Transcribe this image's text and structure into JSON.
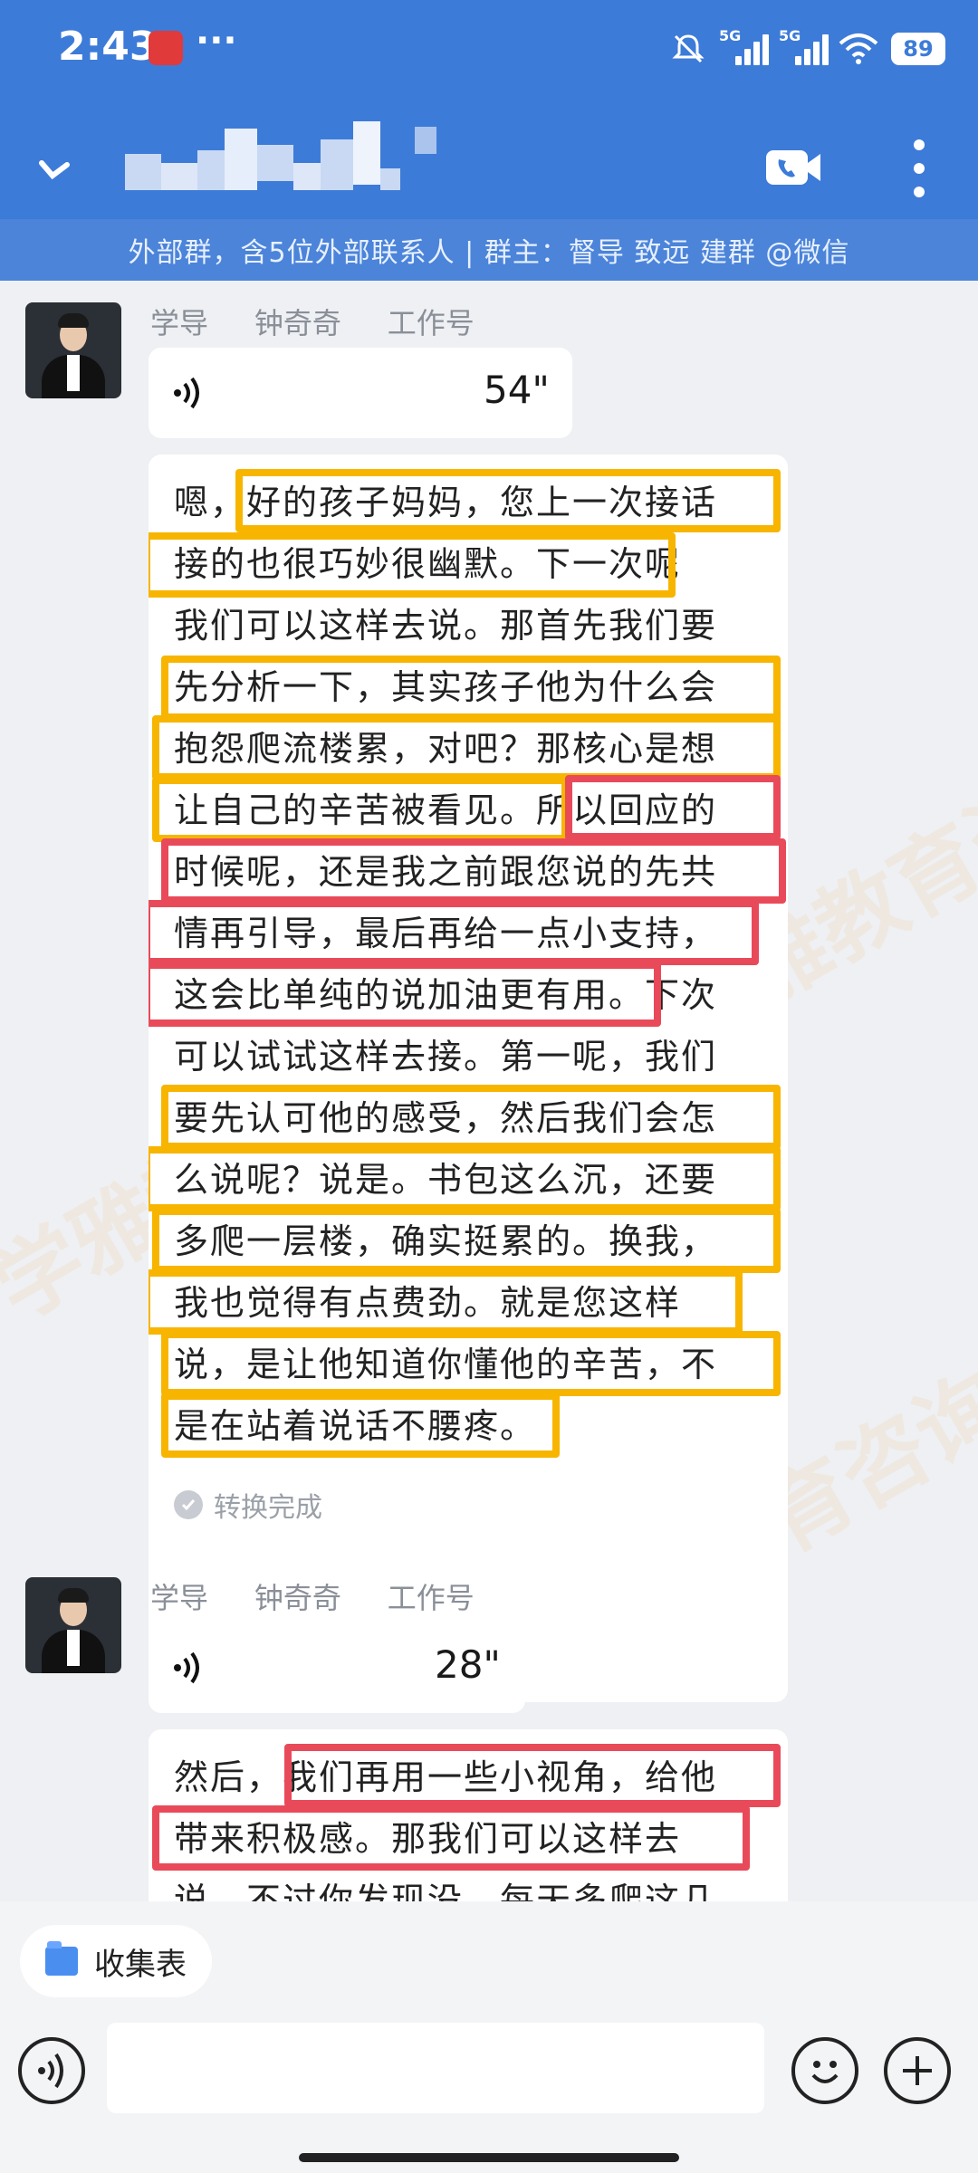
{
  "status_bar": {
    "time": "2:43",
    "app_badge_icon": "app-notification-icon",
    "more_dots": "···",
    "signal1_label": "5G",
    "signal2_label": "5G",
    "battery": "89"
  },
  "header": {
    "title_pixelated": true,
    "back_icon": "back-arrow-icon",
    "video_call_icon": "video-call-icon",
    "more_icon": "more-vertical-icon"
  },
  "group_info": "外部群，含5位外部联系人 | 群主：督导  致远    建群 @微信",
  "messages": [
    {
      "sender_line": "学导     钟奇奇     工作号",
      "voice_duration": "54\"",
      "transcript_lines": [
        "嗯，好的孩子妈妈，您上一次接话",
        "接的也很巧妙很幽默。下一次呢",
        "我们可以这样去说。那首先我们要",
        "先分析一下，其实孩子他为什么会",
        "抱怨爬流楼累，对吧？那核心是想",
        "让自己的辛苦被看见。所以回应的",
        "时候呢，还是我之前跟您说的先共",
        "情再引导，最后再给一点小支持，",
        "这会比单纯的说加油更有用。下次",
        "可以试试这样去接。第一呢，我们",
        "要先认可他的感受，然后我们会怎",
        "么说呢？说是。书包这么沉，还要",
        "多爬一层楼，确实挺累的。换我，",
        "我也觉得有点费劲。就是您这样",
        "说，是让他知道你懂他的辛苦，不",
        "是在站着说话不腰疼。"
      ],
      "status": "转换完成"
    },
    {
      "sender_line": "学导     钟奇奇     工作号",
      "voice_duration": "28\"",
      "transcript_lines": [
        "然后，我们再用一些小视角，给他",
        "带来积极感。那我们可以这样去",
        "说，不过你发现没，每天多爬这几"
      ]
    }
  ],
  "watermark": "学雅教育咨询",
  "bottom": {
    "chip_label": "收集表",
    "chip_icon": "folder-icon",
    "voice_toggle_icon": "voice-input-icon",
    "emoji_icon": "emoji-icon",
    "plus_icon": "plus-icon"
  },
  "colors": {
    "header_blue": "#3d7bd8",
    "highlight_yellow": "#f7b500",
    "highlight_red": "#e94a5a"
  }
}
